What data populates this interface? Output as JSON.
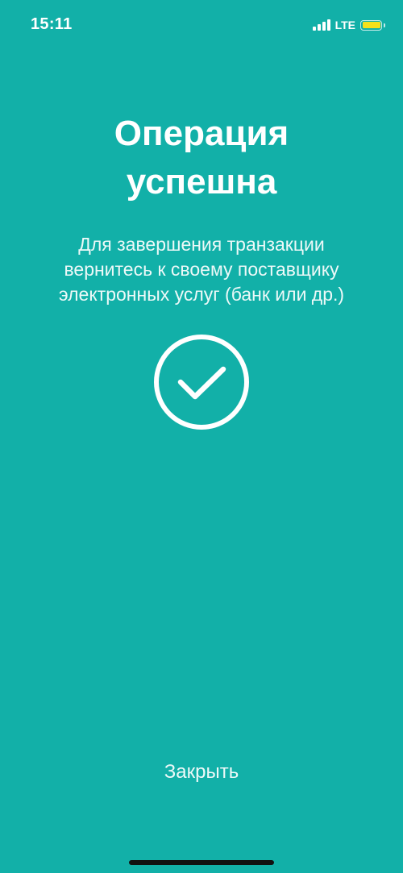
{
  "status_bar": {
    "time": "15:11",
    "network": "LTE",
    "battery_color": "#f5e11b"
  },
  "screen": {
    "background_color": "#12b0a8",
    "title_line1": "Операция",
    "title_line2": "успешна",
    "subtitle_line1": "Для завершения транзакции",
    "subtitle_line2": "вернитесь к своему поставщику",
    "subtitle_line3": "электронных услуг (банк или др.)",
    "status_icon": "check-circle-icon",
    "close_label": "Закрыть"
  }
}
